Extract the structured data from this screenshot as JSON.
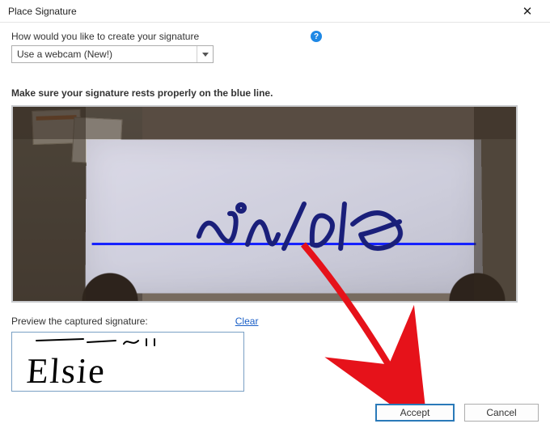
{
  "titlebar": {
    "title": "Place Signature",
    "close_glyph": "✕"
  },
  "method": {
    "label": "How would you like to create your signature",
    "selected": "Use a webcam (New!)",
    "help_glyph": "?"
  },
  "instruction": "Make sure your signature rests properly on the blue line.",
  "preview": {
    "label": "Preview the captured signature:",
    "clear": "Clear",
    "captured_text": "Elsie"
  },
  "buttons": {
    "accept": "Accept",
    "cancel": "Cancel"
  }
}
